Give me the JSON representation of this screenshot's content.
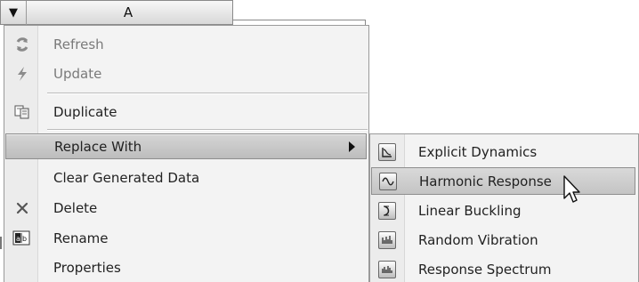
{
  "header": {
    "dropdown_icon": "chevron-down-icon",
    "column_label": "A"
  },
  "context_menu": {
    "items": [
      {
        "label": "Refresh",
        "icon": "refresh-icon",
        "disabled": true
      },
      {
        "label": "Update",
        "icon": "lightning-icon",
        "disabled": true
      },
      {
        "label": "Duplicate",
        "icon": "duplicate-icon",
        "disabled": false
      },
      {
        "label": "Replace With",
        "icon": "",
        "disabled": false,
        "selected": true,
        "has_submenu": true
      },
      {
        "label": "Clear Generated Data",
        "icon": "",
        "disabled": false
      },
      {
        "label": "Delete",
        "icon": "close-icon",
        "disabled": false
      },
      {
        "label": "Rename",
        "icon": "rename-icon",
        "disabled": false
      },
      {
        "label": "Properties",
        "icon": "",
        "disabled": false
      }
    ]
  },
  "submenu": {
    "items": [
      {
        "label": "Explicit Dynamics",
        "icon": "explicit-dynamics-icon"
      },
      {
        "label": "Harmonic Response",
        "icon": "harmonic-response-icon",
        "hovered": true
      },
      {
        "label": "Linear Buckling",
        "icon": "linear-buckling-icon"
      },
      {
        "label": "Random Vibration",
        "icon": "random-vibration-icon"
      },
      {
        "label": "Response Spectrum",
        "icon": "response-spectrum-icon"
      }
    ]
  },
  "colors": {
    "menu_background": "#f3f3f3",
    "selection": "#c8c8c8",
    "border": "#8e8e8e",
    "disabled_text": "#7a7a7a"
  }
}
